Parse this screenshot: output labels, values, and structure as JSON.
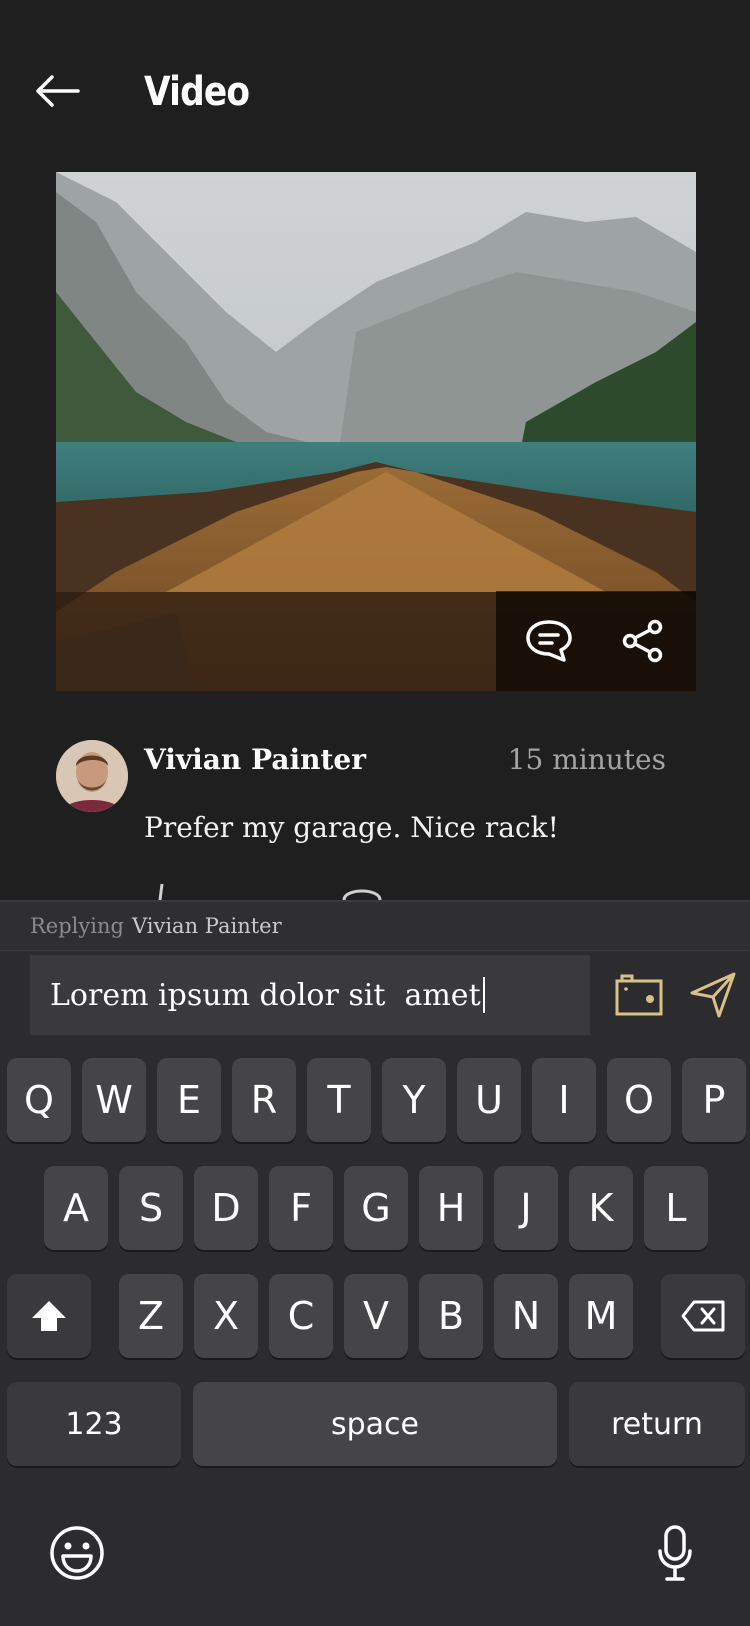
{
  "header": {
    "title": "Video",
    "back_icon": "arrow-left-icon"
  },
  "media": {
    "comment_icon": "comment-icon",
    "share_icon": "share-icon"
  },
  "comment": {
    "author": "Vivian Painter",
    "time": "15 minutes",
    "text": "Prefer my garage. Nice rack!"
  },
  "reply": {
    "label": "Replying",
    "to": "Vivian Painter",
    "input_value": "Lorem ipsum dolor sit  amet"
  },
  "keyboard": {
    "row1": [
      "Q",
      "W",
      "E",
      "R",
      "T",
      "Y",
      "U",
      "I",
      "O",
      "P"
    ],
    "row2": [
      "A",
      "S",
      "D",
      "F",
      "G",
      "H",
      "J",
      "K",
      "L"
    ],
    "row3": [
      "Z",
      "X",
      "C",
      "V",
      "B",
      "N",
      "M"
    ],
    "numbers_label": "123",
    "space_label": "space",
    "return_label": "return"
  },
  "colors": {
    "background": "#1f1f20",
    "accent": "#d9c08a",
    "keyboard": "#2c2c2e",
    "key": "#454547"
  }
}
